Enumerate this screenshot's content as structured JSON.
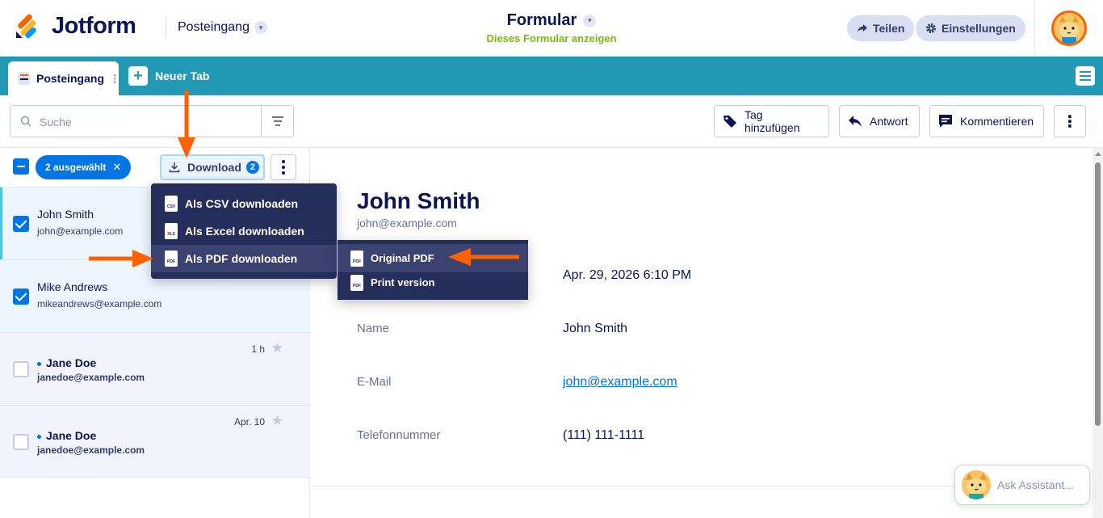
{
  "header": {
    "brand": "Jotform",
    "inbox_label": "Posteingang",
    "form_title": "Formular",
    "form_link": "Dieses Formular anzeigen",
    "share_label": "Teilen",
    "settings_label": "Einstellungen"
  },
  "tabs": {
    "active_label": "Posteingang",
    "new_tab_label": "Neuer Tab"
  },
  "toolbar": {
    "search_placeholder": "Suche",
    "tag_label": "Tag hinzufügen",
    "reply_label": "Antwort",
    "comment_label": "Kommentieren"
  },
  "selection": {
    "chip_label": "2 ausgewählt",
    "download_label": "Download",
    "download_count": "2"
  },
  "download_menu": {
    "items": [
      {
        "icon": "CSV",
        "label": "Als CSV downloaden"
      },
      {
        "icon": "XLS",
        "label": "Als Excel downloaden"
      },
      {
        "icon": "PDF",
        "label": "Als PDF downloaden"
      }
    ],
    "pdf_submenu": [
      {
        "icon": "PDF",
        "label": "Original PDF"
      },
      {
        "icon": "PDF",
        "label": "Print version"
      }
    ]
  },
  "submissions": [
    {
      "name": "John Smith",
      "email": "john@example.com",
      "time": "",
      "checked": true,
      "unread": false
    },
    {
      "name": "Mike Andrews",
      "email": "mikeandrews@example.com",
      "time": "",
      "checked": true,
      "unread": false
    },
    {
      "name": "Jane Doe",
      "email": "janedoe@example.com",
      "time": "1 h",
      "checked": false,
      "unread": true
    },
    {
      "name": "Jane Doe",
      "email": "janedoe@example.com",
      "time": "Apr. 10",
      "checked": false,
      "unread": true
    }
  ],
  "detail": {
    "name": "John Smith",
    "email": "john@example.com",
    "date_value": "Apr. 29, 2026 6:10 PM",
    "fields": [
      {
        "label": "Name",
        "value": "John Smith"
      },
      {
        "label": "E-Mail",
        "value": "john@example.com"
      },
      {
        "label": "Telefonnummer",
        "value": "(111) 111-1111"
      }
    ]
  },
  "assistant": {
    "label": "Ask Assistant..."
  },
  "colors": {
    "accent": "#0075e3",
    "tabbar": "#239ab5",
    "annotation_arrow": "#ff6100",
    "menu_bg": "#252d5b"
  }
}
